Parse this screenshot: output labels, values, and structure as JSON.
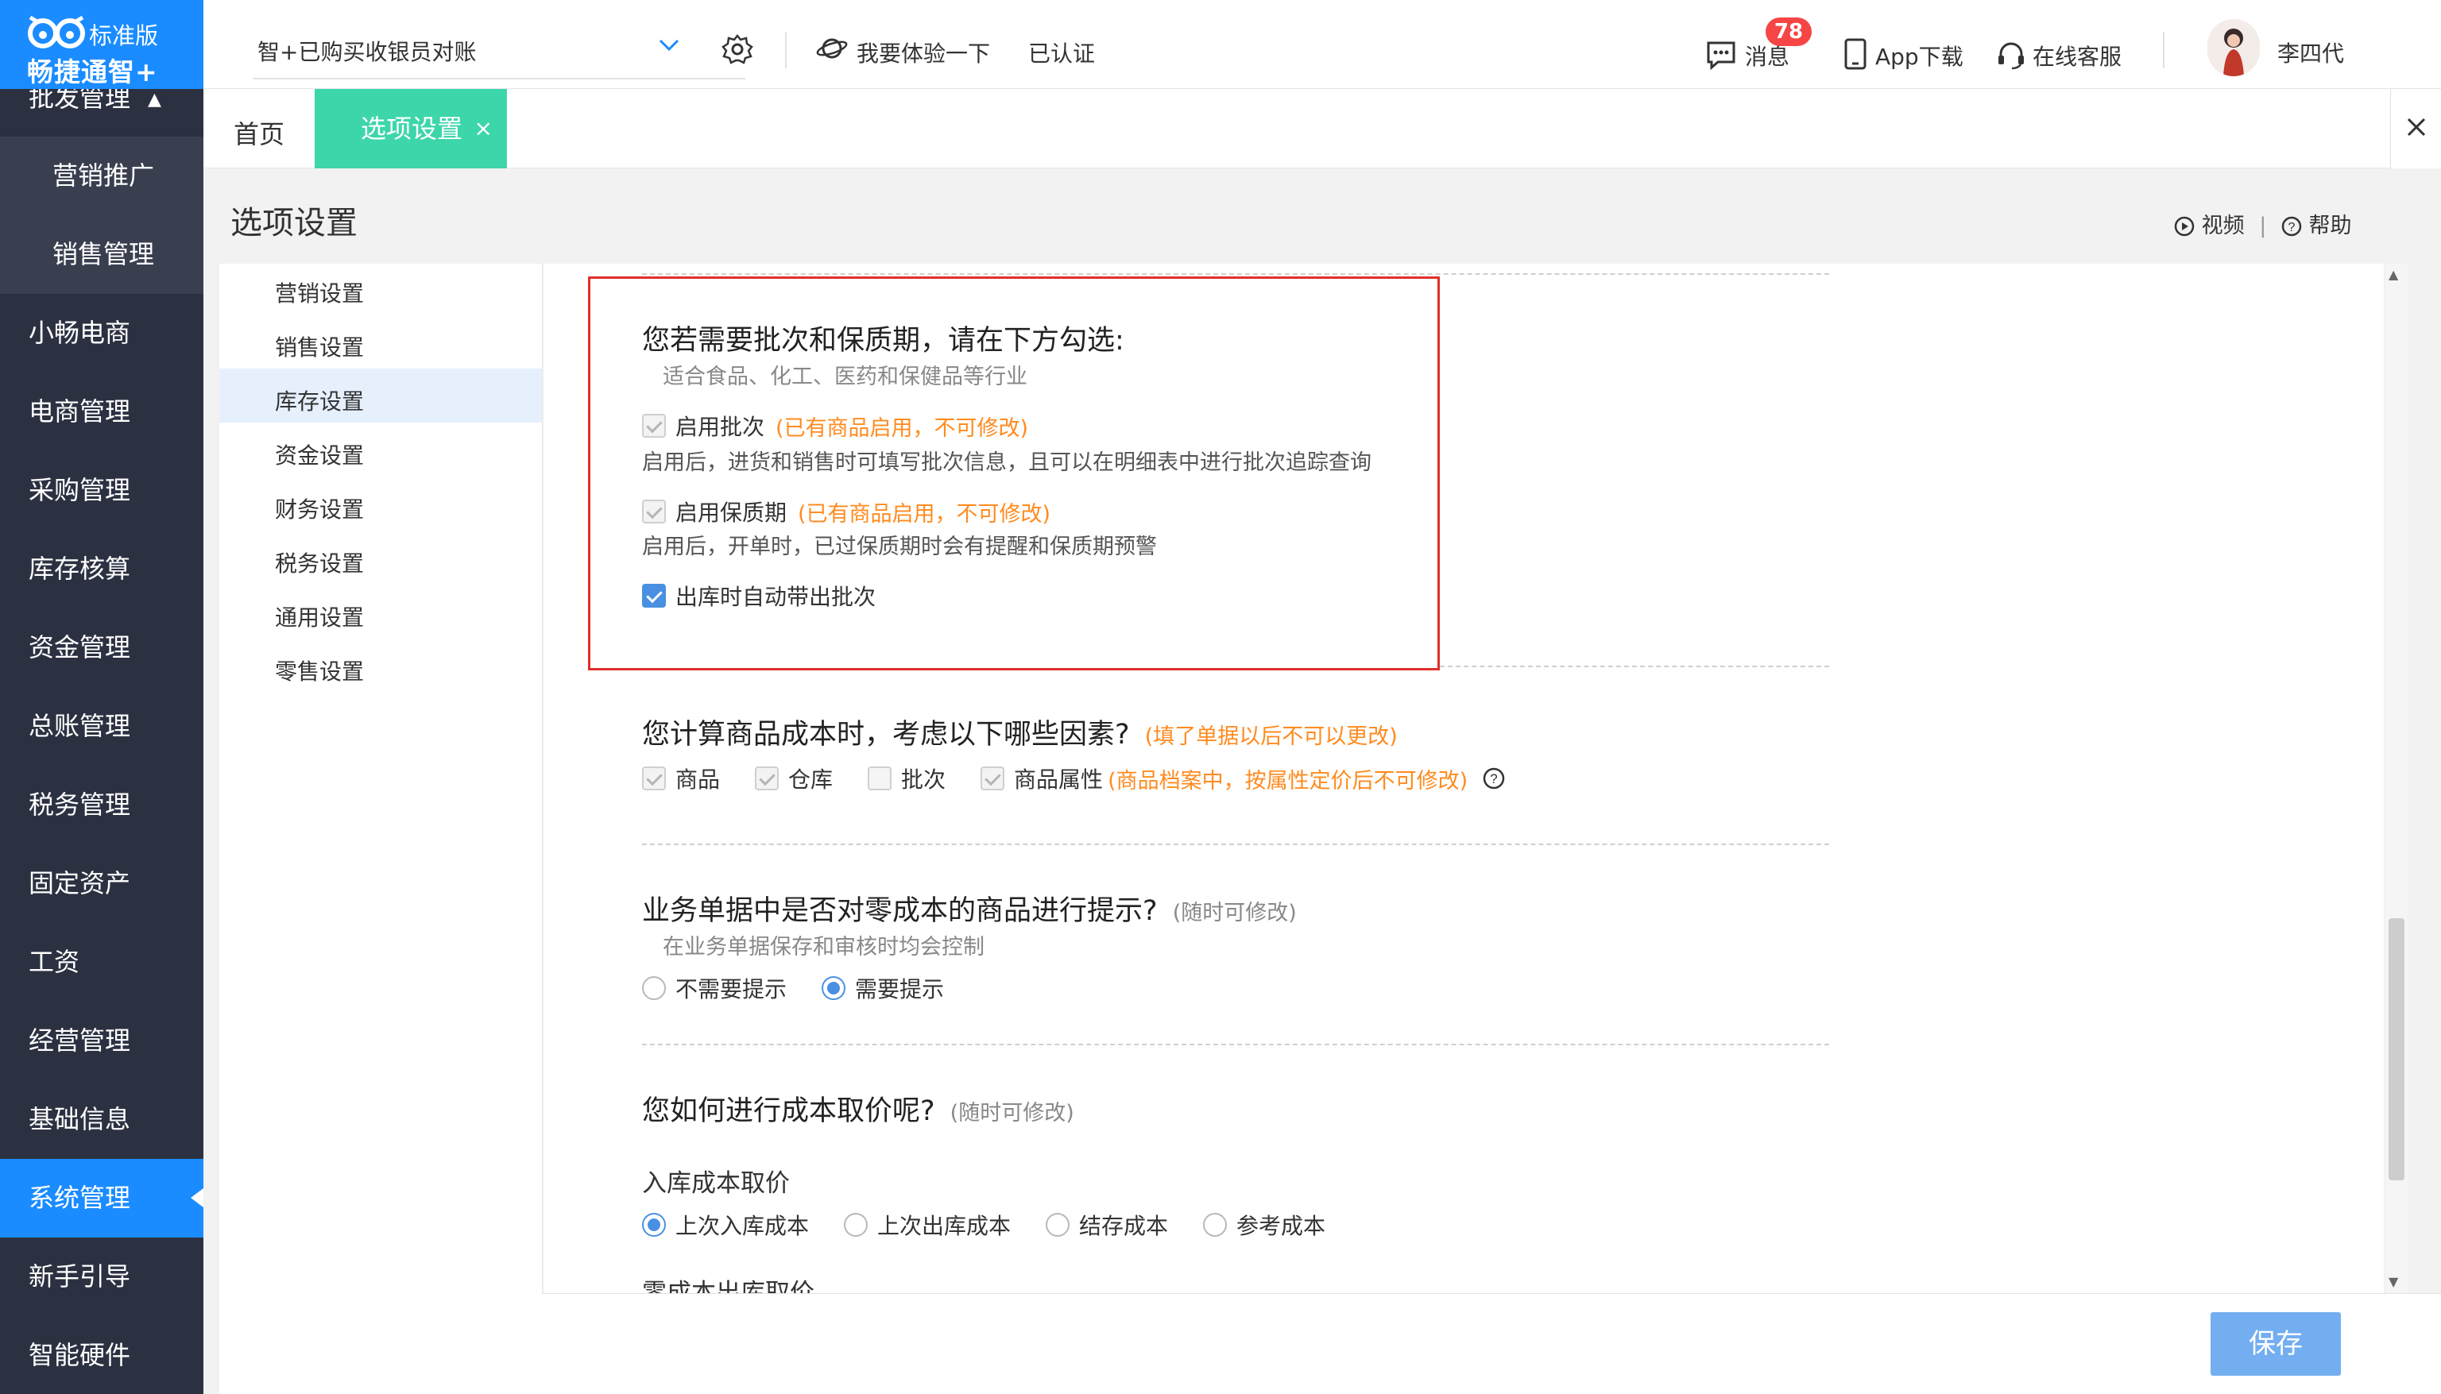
{
  "app": {
    "edition": "标准版",
    "brand": "畅捷通智+"
  },
  "sidebar": {
    "partial_top": "批发管理",
    "sub_items": [
      "营销推广",
      "销售管理"
    ],
    "items": [
      "小畅电商",
      "电商管理",
      "采购管理",
      "库存核算",
      "资金管理",
      "总账管理",
      "税务管理",
      "固定资产",
      "工资",
      "经营管理",
      "基础信息",
      "系统管理",
      "新手引导",
      "智能硬件"
    ],
    "active": "系统管理"
  },
  "topbar": {
    "account": "智+已购买收银员对账",
    "try_label": "我要体验一下",
    "certified": "已认证",
    "messages_label": "消息",
    "messages_count": "78",
    "app_download": "App下载",
    "online_service": "在线客服",
    "username": "李四代"
  },
  "tabs": {
    "home": "首页",
    "active": "选项设置",
    "close_glyph": "×"
  },
  "page": {
    "title": "选项设置",
    "video_label": "视频",
    "help_label": "帮助"
  },
  "categories": [
    "营销设置",
    "销售设置",
    "库存设置",
    "资金设置",
    "财务设置",
    "税务设置",
    "通用设置",
    "零售设置"
  ],
  "active_category": "库存设置",
  "batch_section": {
    "title": "您若需要批次和保质期，请在下方勾选:",
    "subtitle": "适合食品、化工、医药和保健品等行业",
    "enable_batch": "启用批次",
    "enable_batch_note": "(已有商品启用，不可修改)",
    "enable_batch_desc": "启用后，进货和销售时可填写批次信息，且可以在明细表中进行批次追踪查询",
    "enable_shelf": "启用保质期",
    "enable_shelf_note": "(已有商品启用，不可修改)",
    "enable_shelf_desc": "启用后，开单时，已过保质期时会有提醒和保质期预警",
    "auto_batch": "出库时自动带出批次"
  },
  "cost_section": {
    "title": "您计算商品成本时，考虑以下哪些因素?",
    "note": "(填了单据以后不可以更改)",
    "opt_goods": "商品",
    "opt_warehouse": "仓库",
    "opt_batch": "批次",
    "opt_attr": "商品属性",
    "opt_attr_note": "(商品档案中，按属性定价后不可修改)"
  },
  "zero_section": {
    "title": "业务单据中是否对零成本的商品进行提示?",
    "note": "(随时可修改)",
    "subtitle": "在业务单据保存和审核时均会控制",
    "opt_no": "不需要提示",
    "opt_yes": "需要提示"
  },
  "price_section": {
    "title": "您如何进行成本取价呢?",
    "note": "(随时可修改)",
    "inbound_label": "入库成本取价",
    "opt_last_in": "上次入库成本",
    "opt_last_out": "上次出库成本",
    "opt_stock": "结存成本",
    "opt_ref": "参考成本",
    "zero_out_label": "零成本出库取价"
  },
  "footer": {
    "save": "保存"
  },
  "colors": {
    "sidebar_bg": "#2c3142",
    "accent_blue": "#1a8cff",
    "tab_green": "#3dd6aa",
    "warning_orange": "#ff8b1f",
    "highlight_red": "#e0302a"
  }
}
